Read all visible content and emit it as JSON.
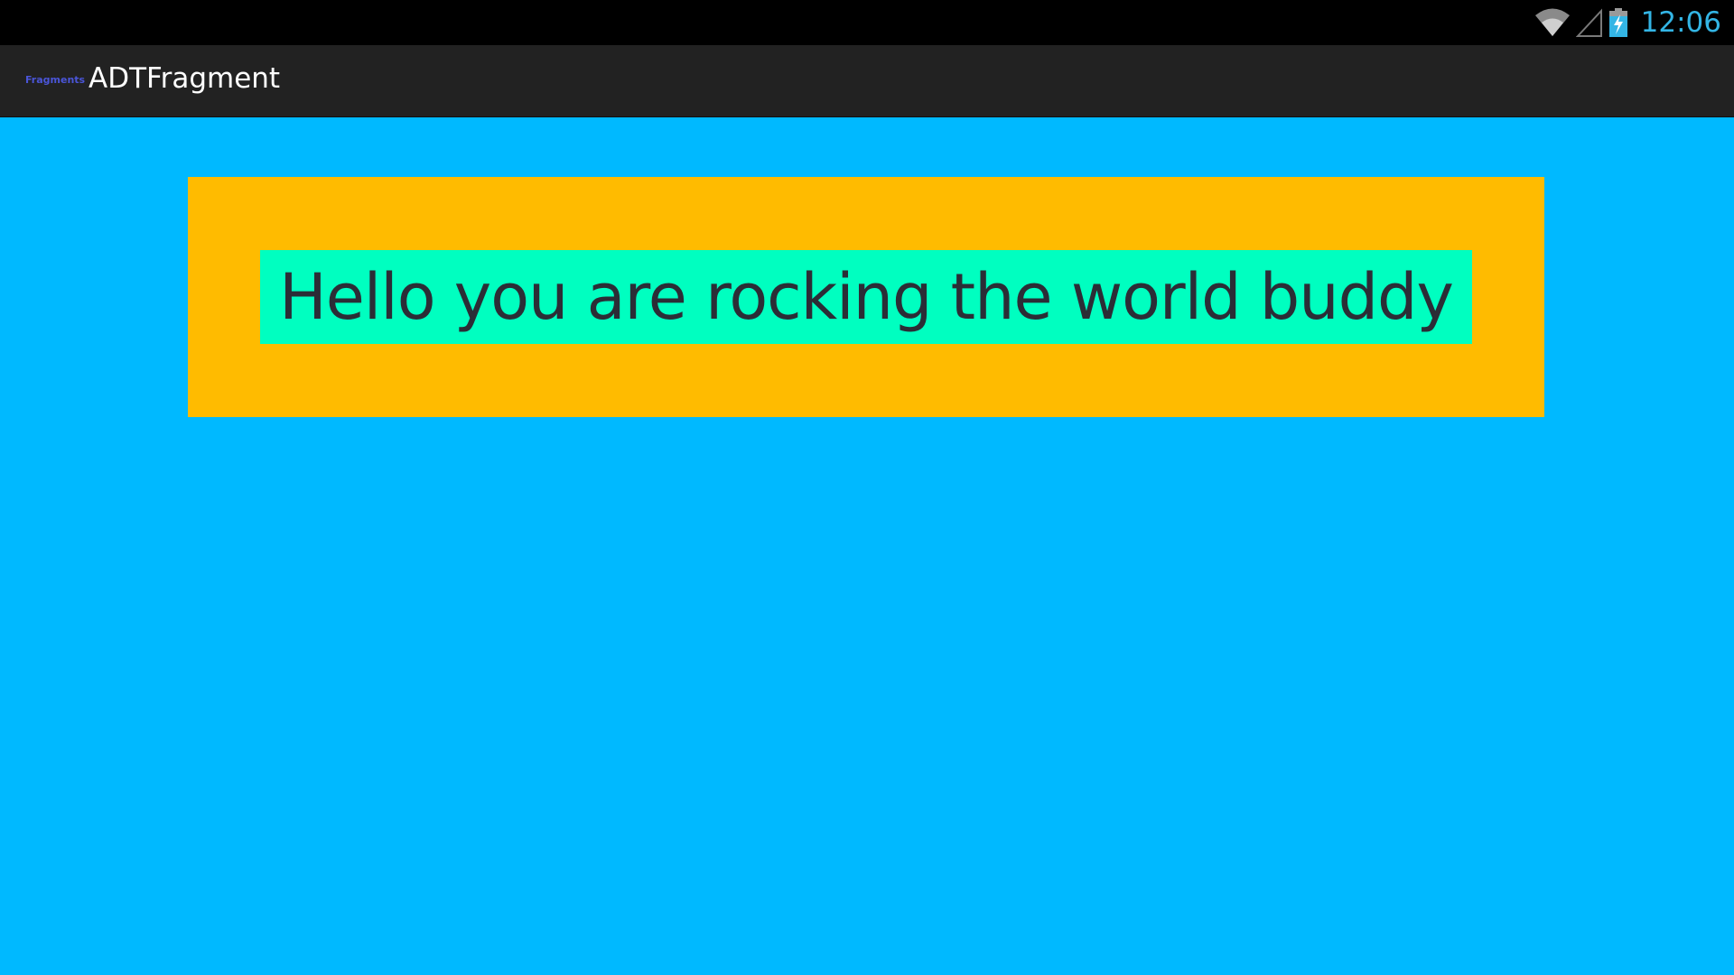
{
  "status_bar": {
    "time": "12:06",
    "icons": [
      "wifi-icon",
      "signal-icon",
      "battery-charging-icon"
    ],
    "clock_color": "#33b5e5"
  },
  "action_bar": {
    "app_icon_label": "Fragments",
    "title": "ADTFragment"
  },
  "fragment": {
    "text": "Hello you are rocking the world buddy",
    "text_background": "#00ffc0",
    "container_background": "#ffbb00"
  },
  "screen_background": "#00b9ff"
}
